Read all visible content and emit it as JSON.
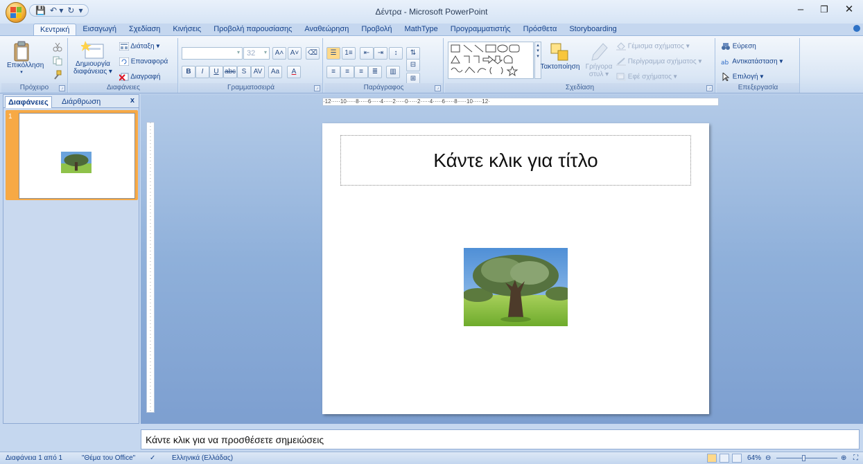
{
  "window": {
    "title": "Δέντρα - Microsoft PowerPoint",
    "minimize": "–",
    "maximize": "❐",
    "close": "✕"
  },
  "qat": {
    "save": "💾",
    "undo": "↶ ▾",
    "redo": "↻",
    "customize": "▾"
  },
  "tabs": [
    "Κεντρική",
    "Εισαγωγή",
    "Σχεδίαση",
    "Κινήσεις",
    "Προβολή παρουσίασης",
    "Αναθεώρηση",
    "Προβολή",
    "MathType",
    "Προγραμματιστής",
    "Πρόσθετα",
    "Storyboarding"
  ],
  "ribbon": {
    "clipboard": {
      "label": "Πρόχειρο",
      "paste": "Επικόλληση"
    },
    "slides": {
      "label": "Διαφάνειες",
      "new_slide_1": "Δημιουργία",
      "new_slide_2": "διαφάνειας ▾",
      "layout": "Διάταξη ▾",
      "reset": "Επαναφορά",
      "delete": "Διαγραφή"
    },
    "font": {
      "label": "Γραμματοσειρά",
      "size": "32"
    },
    "paragraph": {
      "label": "Παράγραφος"
    },
    "drawing": {
      "label": "Σχεδίαση",
      "arrange": "Τακτοποίηση",
      "quick_styles_1": "Γρήγορα",
      "quick_styles_2": "στυλ ▾",
      "fill": "Γέμισμα σχήματος ▾",
      "outline": "Περίγραμμα σχήματος ▾",
      "effects": "Εφέ σχήματος ▾"
    },
    "editing": {
      "label": "Επεξεργασία",
      "find": "Εύρεση",
      "replace": "Αντικατάσταση ▾",
      "select": "Επιλογή ▾"
    }
  },
  "leftpane": {
    "tab_slides": "Διαφάνειες",
    "tab_outline": "Διάρθρωση",
    "close": "x",
    "slide_number": "1"
  },
  "ruler": {
    "h": "·12·····10·····8·····6·····4·····2·····0·····2·····4·····6·····8·····10·····12·"
  },
  "slide": {
    "title_placeholder": "Κάντε κλικ για τίτλο"
  },
  "notes": {
    "placeholder": "Κάντε κλικ για να προσθέσετε σημειώσεις"
  },
  "status": {
    "slide": "Διαφάνεια 1 από 1",
    "theme": "\"Θέμα του Office\"",
    "language": "Ελληνικά (Ελλάδας)",
    "zoom": "64%"
  },
  "colors": {
    "accent": "#f7a945",
    "ribbon_text": "#15428b",
    "background": "#8fb0da"
  }
}
